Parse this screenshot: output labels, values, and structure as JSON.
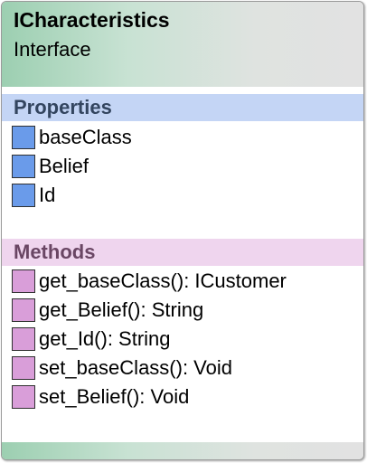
{
  "class": {
    "name": "ICharacteristics",
    "stereotype": "Interface"
  },
  "properties": {
    "title": "Properties",
    "items": [
      "baseClass",
      "Belief",
      "Id"
    ]
  },
  "methods": {
    "title": "Methods",
    "items": [
      "get_baseClass(): ICustomer",
      "get_Belief(): String",
      "get_Id(): String",
      "set_baseClass(): Void",
      "set_Belief(): Void"
    ]
  },
  "colors": {
    "header_gradient_start": "#9ccfb1",
    "header_gradient_end": "#e2e2e2",
    "properties_band": "#c4d5f5",
    "properties_title_text": "#33455f",
    "property_icon": "#6a9bea",
    "methods_band": "#efd5ee",
    "methods_title_text": "#6a4664",
    "method_icon": "#d99ed9"
  },
  "icons": {
    "property": "property-icon",
    "method": "method-icon"
  }
}
